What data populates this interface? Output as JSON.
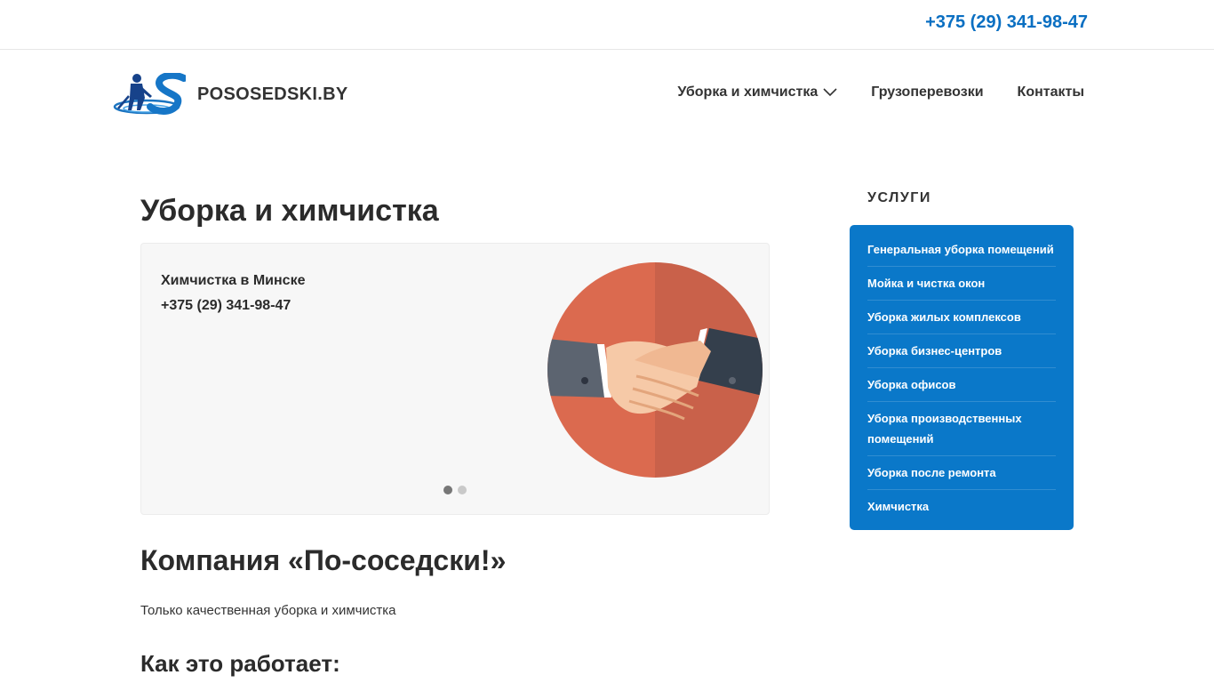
{
  "topbar": {
    "phone": "+375 (29) 341-98-47"
  },
  "header": {
    "logo_text": "POSOSEDSKI.BY",
    "nav": [
      {
        "label": "Уборка и химчистка",
        "has_dropdown": true
      },
      {
        "label": "Грузоперевозки",
        "has_dropdown": false
      },
      {
        "label": "Контакты",
        "has_dropdown": false
      }
    ]
  },
  "main": {
    "title": "Уборка и химчистка",
    "slider": {
      "title": "Химчистка в Минске",
      "phone": "+375 (29) 341-98-47",
      "image": "handshake-illustration",
      "dots": 2,
      "active_dot": 1
    },
    "company_title": "Компания «По-соседски!»",
    "intro": "Только качественная уборка и химчистка",
    "how_title": "Как это работает:"
  },
  "sidebar": {
    "heading": "УСЛУГИ",
    "items": [
      "Генеральная уборка помещений",
      "Мойка и чистка окон",
      "Уборка жилых комплексов",
      "Уборка бизнес-центров",
      "Уборка офисов",
      "Уборка производственных помещений",
      "Уборка после ремонта",
      "Химчистка"
    ]
  },
  "colors": {
    "accent": "#0a78c9",
    "phone": "#0a6fc2",
    "text": "#2b2b2b"
  }
}
